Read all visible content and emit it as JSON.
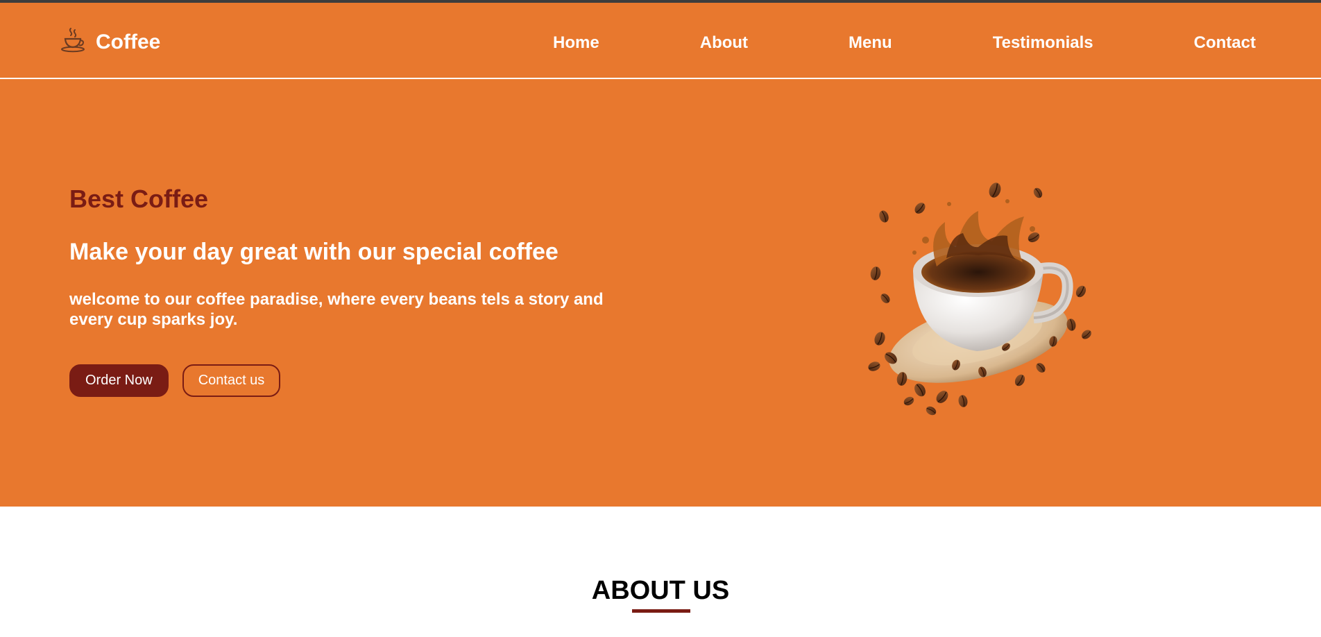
{
  "colors": {
    "brand_orange": "#e8782e",
    "accent_maroon": "#7a1c14",
    "text_light": "#ffffff",
    "top_strip": "#3d3d3d"
  },
  "header": {
    "logo_icon": "coffee-cup-icon",
    "brand": "Coffee",
    "nav": [
      "Home",
      "About",
      "Menu",
      "Testimonials",
      "Contact"
    ]
  },
  "hero": {
    "eyebrow": "Best Coffee",
    "headline": "Make your day great with our special coffee",
    "intro": "welcome to our coffee paradise, where every beans tels a story and every cup sparks joy.",
    "primary_button": "Order Now",
    "secondary_button": "Contact us",
    "image_subject": "coffee-cup-splash-illustration"
  },
  "about": {
    "title": "ABOUT US"
  }
}
